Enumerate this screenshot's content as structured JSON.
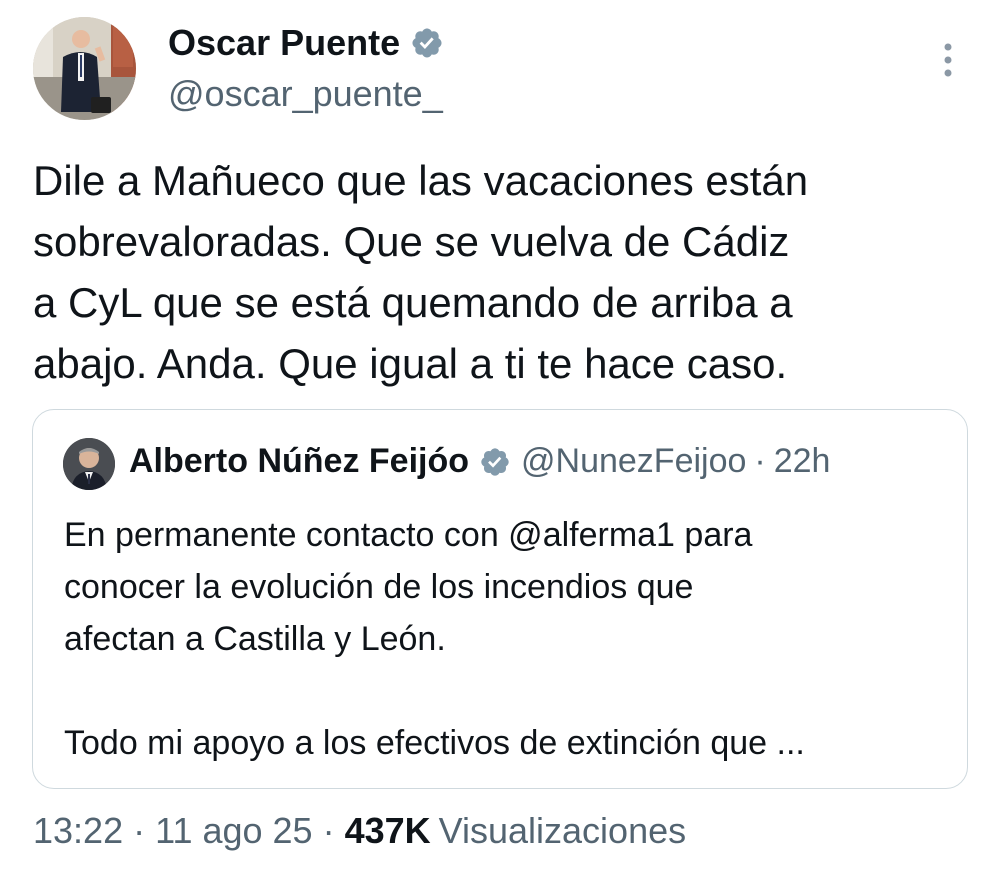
{
  "author": {
    "display_name": "Oscar Puente",
    "handle": "@oscar_puente_",
    "verified": true,
    "avatar_icon": "person-with-briefcase-avatar"
  },
  "tweet": {
    "text_lines": [
      "Dile a Mañueco que las vacaciones están",
      "sobrevaloradas. Que se vuelva de Cádiz",
      "a CyL que se está quemando de arriba a",
      "abajo. Anda. Que igual a ti te hace caso."
    ]
  },
  "quoted": {
    "display_name": "Alberto Núñez Feijóo",
    "handle": "@NunezFeijoo",
    "separator": "·",
    "time": "22h",
    "verified": true,
    "text_lines": [
      "En permanente contacto con @alferma1 para",
      "conocer la evolución de los incendios que",
      "afectan a Castilla y León."
    ],
    "text_line_2": "Todo mi apoyo a los efectivos de extinción que ..."
  },
  "meta": {
    "time": "13:22",
    "separator": "·",
    "date": "11 ago 25",
    "views_count": "437K",
    "views_label": "Visualizaciones"
  },
  "colors": {
    "verified_badge": "#829aab",
    "secondary_text": "#536471",
    "primary_text": "#0f1419",
    "border": "#cfd9de"
  }
}
